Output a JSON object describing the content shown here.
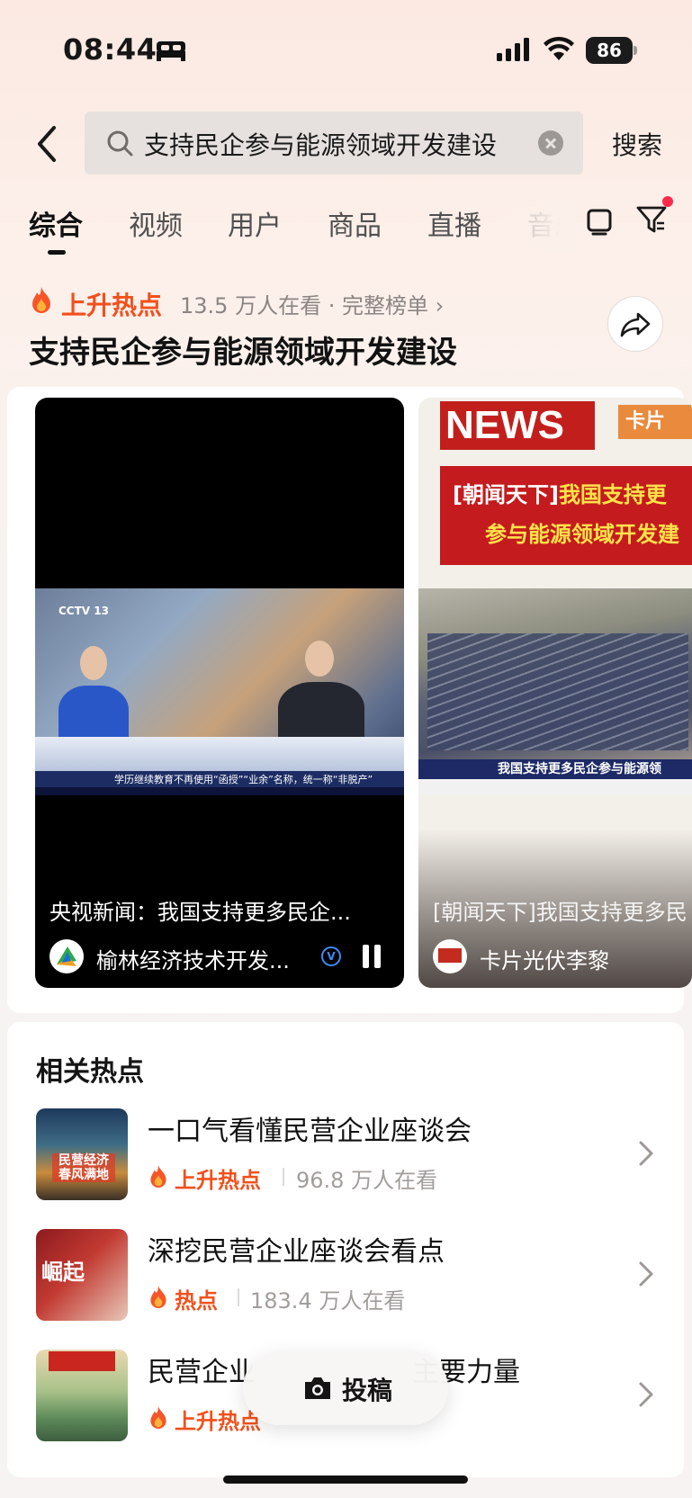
{
  "status_bar": {
    "time": "08:44",
    "battery": "86"
  },
  "search": {
    "query": "支持民企参与能源领域开发建设",
    "button_label": "搜索"
  },
  "tabs": [
    "综合",
    "视频",
    "用户",
    "商品",
    "直播",
    "音乐"
  ],
  "hot": {
    "badge": "上升热点",
    "meta": "13.5 万人在看 · 完整榜单 ›",
    "title": "支持民企参与能源领域开发建设"
  },
  "videos": [
    {
      "caption": "央视新闻：我国支持更多民企...",
      "author": "榆林经济技术开发...",
      "logo_text": "CCTV 13",
      "ticker": "学历继续教育不再使用“函授”“业余”名称，统一称“非脱产”"
    },
    {
      "caption": "[朝闻天下]我国支持更多民",
      "author": "卡片光伏李黎",
      "headline_box": "NEWS",
      "tag": "卡片",
      "banner_line1_prefix": "[朝闻天下]",
      "banner_line1_highlight": "我国支持更",
      "banner_line2": "参与能源领域开发建",
      "ticker": "我国支持更多民企参与能源领"
    }
  ],
  "related": {
    "title": "相关热点",
    "items": [
      {
        "name": "一口气看懂民营企业座谈会",
        "badge": "上升热点",
        "views": "96.8 万人在看",
        "thumb_text": "民营经济 春风满地"
      },
      {
        "name": "深挖民营企业座谈会看点",
        "badge": "热点",
        "views": "183.4 万人在看",
        "thumb_text": "崛起"
      },
      {
        "name": "民营企业",
        "name_tail": "主要力量",
        "badge": "上升热点",
        "views": ""
      }
    ]
  },
  "post_button": {
    "label": "投稿"
  },
  "colors": {
    "accent_orange": "#f2501c",
    "notification_red": "#ff2a4a",
    "verify_blue": "#3d8cf5"
  },
  "icons": [
    "back-arrow-icon",
    "search-icon",
    "clear-icon",
    "tv-icon",
    "filter-icon",
    "flame-icon",
    "share-icon",
    "pause-icon",
    "camera-icon",
    "chevron-right-icon"
  ]
}
